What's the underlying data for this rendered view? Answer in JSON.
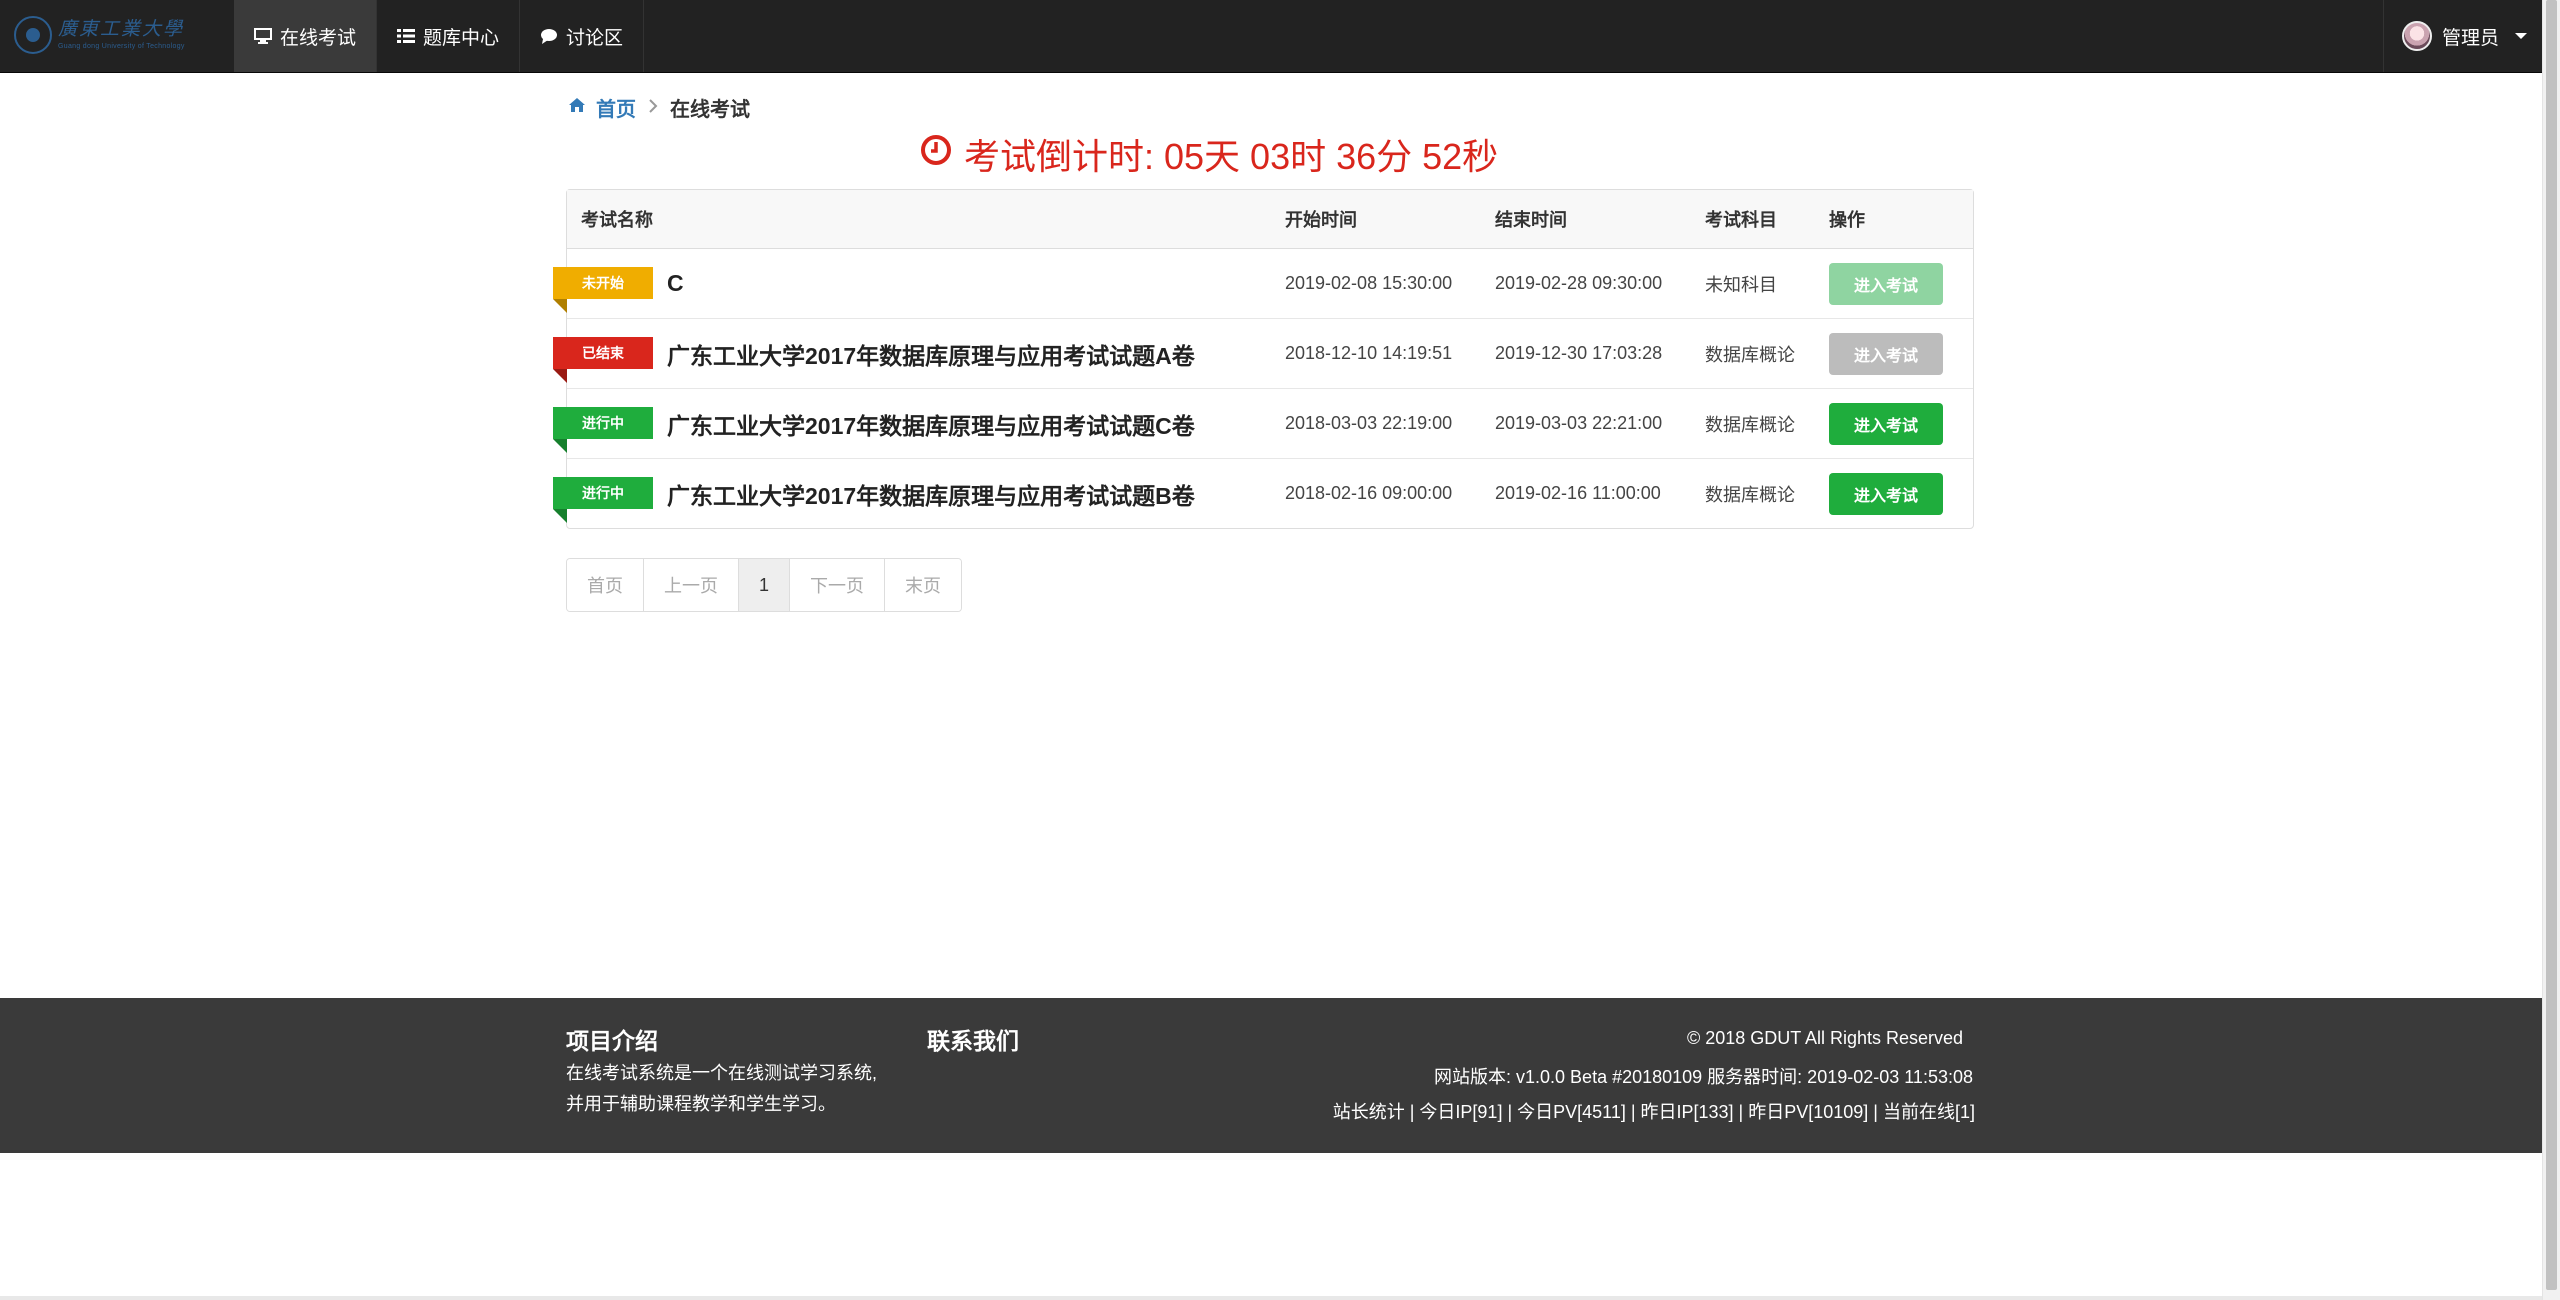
{
  "brand": {
    "name_cn": "廣東工業大學",
    "name_en": "Guang dong University of Technology"
  },
  "nav": {
    "tabs": [
      {
        "label": "在线考试",
        "icon": "desktop-icon",
        "active": true
      },
      {
        "label": "题库中心",
        "icon": "list-icon",
        "active": false
      },
      {
        "label": "讨论区",
        "icon": "comment-icon",
        "active": false
      }
    ],
    "user": {
      "name": "管理员"
    }
  },
  "breadcrumb": {
    "home": "首页",
    "current": "在线考试"
  },
  "countdown": {
    "text": "考试倒计时: 05天 03时 36分 52秒"
  },
  "table": {
    "headers": {
      "name": "考试名称",
      "start": "开始时间",
      "end": "结束时间",
      "subject": "考试科目",
      "action": "操作"
    },
    "rows": [
      {
        "status": "未开始",
        "name": "C",
        "start": "2019-02-08 15:30:00",
        "end": "2019-02-28 09:30:00",
        "subject": "未知科目",
        "button": "进入考试"
      },
      {
        "status": "已结束",
        "name": "广东工业大学2017年数据库原理与应用考试试题A卷",
        "start": "2018-12-10 14:19:51",
        "end": "2019-12-30 17:03:28",
        "subject": "数据库概论",
        "button": "进入考试"
      },
      {
        "status": "进行中",
        "name": "广东工业大学2017年数据库原理与应用考试试题C卷",
        "start": "2018-03-03 22:19:00",
        "end": "2019-03-03 22:21:00",
        "subject": "数据库概论",
        "button": "进入考试"
      },
      {
        "status": "进行中",
        "name": "广东工业大学2017年数据库原理与应用考试试题B卷",
        "start": "2018-02-16 09:00:00",
        "end": "2019-02-16 11:00:00",
        "subject": "数据库概论",
        "button": "进入考试"
      }
    ]
  },
  "pagination": {
    "first": "首页",
    "prev": "上一页",
    "current": "1",
    "next": "下一页",
    "last": "末页"
  },
  "footer": {
    "about_title": "项目介绍",
    "about_line1": "在线考试系统是一个在线测试学习系统,",
    "about_line2": "并用于辅助课程教学和学生学习。",
    "contact_title": "联系我们",
    "copyright": "© 2018 GDUT All Rights Reserved",
    "version": "网站版本:  v1.0.0 Beta #20180109   服务器时间:  2019-02-03 11:53:08",
    "stats": "站长统计 | 今日IP[91] | 今日PV[4511] | 昨日IP[133] | 昨日PV[10109] | 当前在线[1]"
  },
  "colors": {
    "navbar_bg": "#222222",
    "link_blue": "#337ab7",
    "countdown_red": "#d9261c",
    "status_not_started": "#f0ad00",
    "status_ended": "#d9261c",
    "status_ongoing": "#1fad3d",
    "footer_bg": "#3a3a3a"
  }
}
